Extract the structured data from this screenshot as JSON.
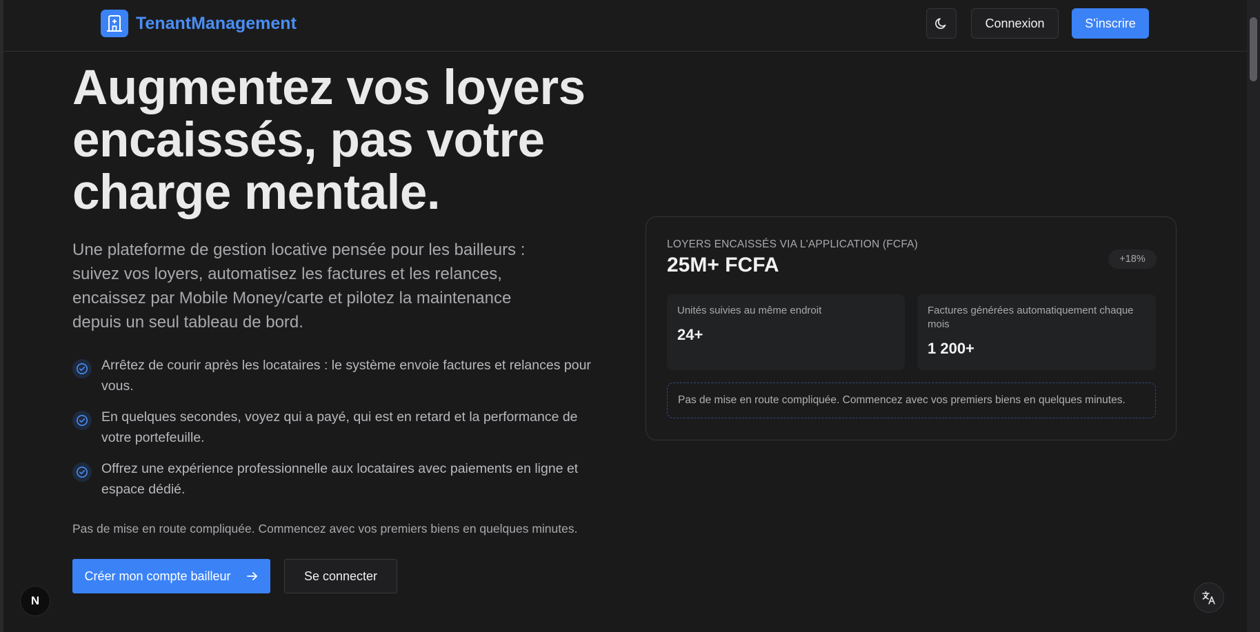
{
  "header": {
    "brand_name": "TenantManagement",
    "login_label": "Connexion",
    "signup_label": "S'inscrire"
  },
  "hero": {
    "title": "Augmentez vos loyers encaissés, pas votre charge mentale.",
    "subtitle": "Une plateforme de gestion locative pensée pour les bailleurs : suivez vos loyers, automatisez les factures et les relances, encaissez par Mobile Money/carte et pilotez la maintenance depuis un seul tableau de bord.",
    "benefits": [
      "Arrêtez de courir après les locataires : le système envoie factures et relances pour vous.",
      "En quelques secondes, voyez qui a payé, qui est en retard et la performance de votre portefeuille.",
      "Offrez une expérience professionnelle aux locataires avec paiements en ligne et espace dédié."
    ],
    "note": "Pas de mise en route compliquée. Commencez avec vos premiers biens en quelques minutes.",
    "cta_primary": "Créer mon compte bailleur",
    "cta_secondary": "Se connecter"
  },
  "stats_card": {
    "label": "LOYERS ENCAISSÉS VIA L'APPLICATION (FCFA)",
    "value": "25M+ FCFA",
    "badge": "+18%",
    "metrics": [
      {
        "label": "Unités suivies au même endroit",
        "value": "24+"
      },
      {
        "label": "Factures générées automatiquement chaque mois",
        "value": "1 200+"
      }
    ],
    "note": "Pas de mise en route compliquée. Commencez avec vos premiers biens en quelques minutes."
  },
  "floating": {
    "next_badge_letter": "N"
  },
  "icons": {
    "brand": "building-icon",
    "theme": "moon-icon",
    "check": "check-circle-icon",
    "arrow": "arrow-right-icon",
    "translate": "translate-icon"
  },
  "colors": {
    "accent": "#3b82f6",
    "background": "#1a1a1b",
    "brand_text": "#4a8ef5"
  }
}
